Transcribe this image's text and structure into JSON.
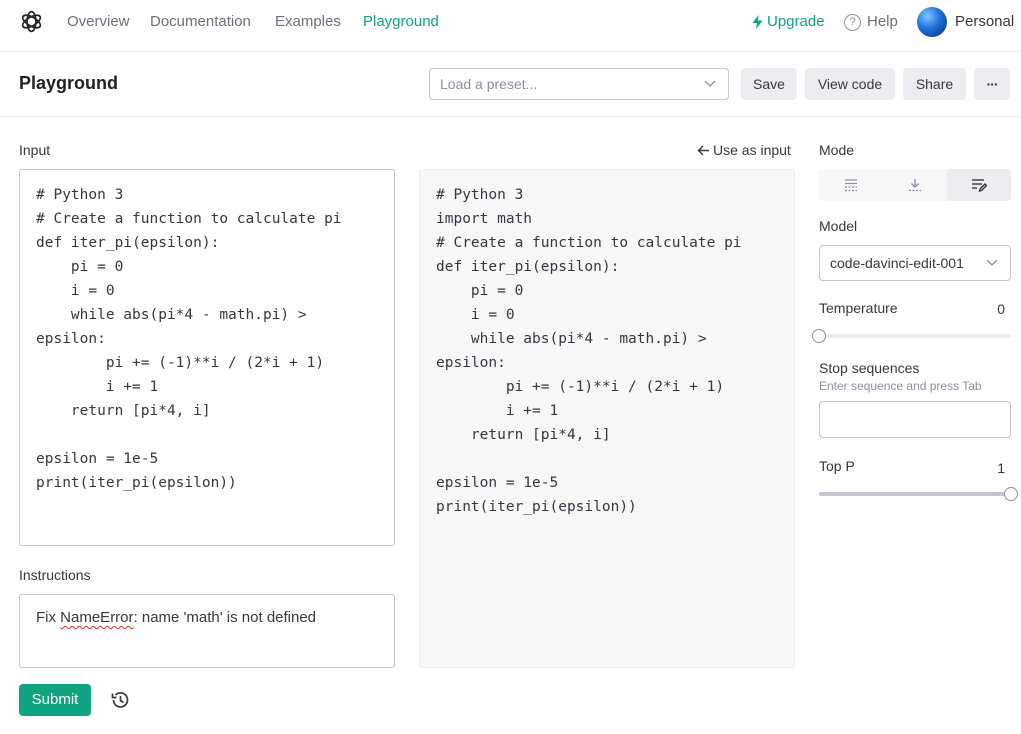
{
  "nav": {
    "logo_icon": "openai-logo-icon",
    "links": [
      "Overview",
      "Documentation",
      "Examples",
      "Playground"
    ],
    "active": "Playground",
    "upgrade": "Upgrade",
    "help": "Help",
    "account": "Personal"
  },
  "header": {
    "title": "Playground",
    "preset_placeholder": "Load a preset...",
    "save": "Save",
    "view_code": "View code",
    "share": "Share",
    "more": "···"
  },
  "input": {
    "label": "Input",
    "code": "# Python 3\n# Create a function to calculate pi\ndef iter_pi(epsilon):\n    pi = 0\n    i = 0\n    while abs(pi*4 - math.pi) >\nepsilon:\n        pi += (-1)**i / (2*i + 1)\n        i += 1\n    return [pi*4, i]\n\nepsilon = 1e-5\nprint(iter_pi(epsilon))"
  },
  "output": {
    "use_as_input": "Use as input",
    "code": "# Python 3\nimport math\n# Create a function to calculate pi\ndef iter_pi(epsilon):\n    pi = 0\n    i = 0\n    while abs(pi*4 - math.pi) >\nepsilon:\n        pi += (-1)**i / (2*i + 1)\n        i += 1\n    return [pi*4, i]\n\nepsilon = 1e-5\nprint(iter_pi(epsilon))"
  },
  "instructions": {
    "label": "Instructions",
    "text_pre": "Fix ",
    "text_err": "NameError",
    "text_post": ": name 'math' is not defined"
  },
  "submit": "Submit",
  "settings": {
    "mode_label": "Mode",
    "mode_options": [
      "complete-icon",
      "insert-icon",
      "edit-icon"
    ],
    "mode_active": "edit-icon",
    "model_label": "Model",
    "model_value": "code-davinci-edit-001",
    "temperature_label": "Temperature",
    "temperature_value": "0",
    "temperature_fraction": 0,
    "stop_label": "Stop sequences",
    "stop_hint": "Enter sequence and press Tab",
    "top_p_label": "Top P",
    "top_p_value": "1",
    "top_p_fraction": 1
  },
  "colors": {
    "accent": "#10a37f",
    "text": "#353740",
    "muted": "#6e6e80"
  }
}
